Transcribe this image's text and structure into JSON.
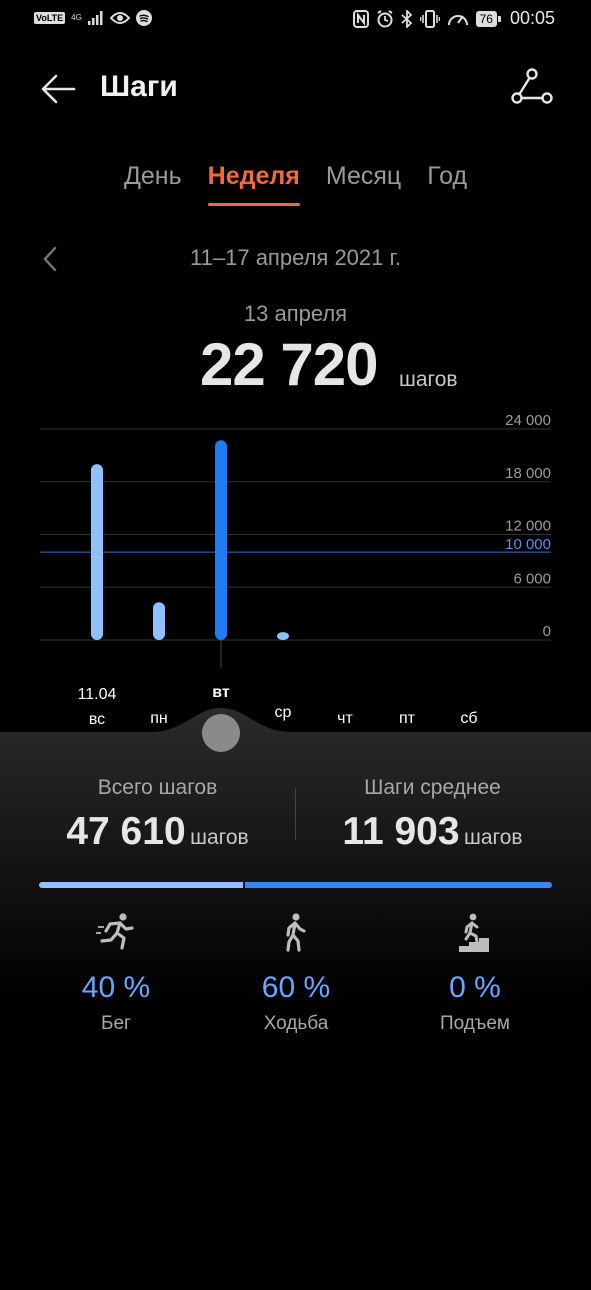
{
  "status_bar": {
    "volte": "VoLTE",
    "network": "4G",
    "battery": "76",
    "time": "00:05"
  },
  "header": {
    "title": "Шаги",
    "back_icon": "arrow-left-icon",
    "share_icon": "share-icon"
  },
  "tabs": [
    {
      "label": "День",
      "active": false
    },
    {
      "label": "Неделя",
      "active": true
    },
    {
      "label": "Месяц",
      "active": false
    },
    {
      "label": "Год",
      "active": false
    }
  ],
  "period": {
    "range": "11–17 апреля 2021 г.",
    "selected_date": "13 апреля",
    "selected_value": "22 720",
    "unit": "шагов"
  },
  "chart_data": {
    "type": "bar",
    "categories": [
      "вс",
      "пн",
      "вт",
      "ср",
      "чт",
      "пт",
      "сб"
    ],
    "first_date_label": "11.04",
    "values": [
      20000,
      4300,
      22720,
      900,
      0,
      0,
      0
    ],
    "selected_index": 2,
    "ylim": [
      0,
      24000
    ],
    "y_ticks": [
      {
        "value": 24000,
        "label": "24 000"
      },
      {
        "value": 18000,
        "label": "18 000"
      },
      {
        "value": 12000,
        "label": "12 000"
      },
      {
        "value": 6000,
        "label": "6 000"
      },
      {
        "value": 0,
        "label": "0"
      }
    ],
    "goal": {
      "value": 10000,
      "label": "10 000"
    },
    "colors": {
      "bar": "#8fc0ff",
      "selected": "#1e7cf2",
      "goal": "#3d6fd0",
      "grid": "#333333"
    },
    "grid": true
  },
  "summary": {
    "total_label": "Всего шагов",
    "total_value": "47 610",
    "total_unit": "шагов",
    "avg_label": "Шаги среднее",
    "avg_value": "11 903",
    "avg_unit": "шагов"
  },
  "activities": [
    {
      "pct": "40 %",
      "name": "Бег",
      "icon": "running-icon",
      "fraction": 0.4
    },
    {
      "pct": "60 %",
      "name": "Ходьба",
      "icon": "walking-icon",
      "fraction": 0.6
    },
    {
      "pct": "0 %",
      "name": "Подъем",
      "icon": "stairs-climb-icon",
      "fraction": 0.0
    }
  ]
}
